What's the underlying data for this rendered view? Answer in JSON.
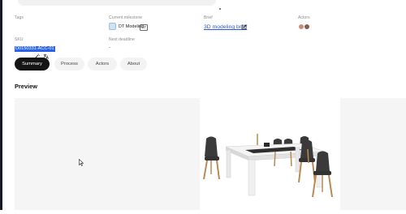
{
  "fields": {
    "tags_label": "Tags",
    "milestone_label": "Current milestone",
    "milestone_value": "DT Modeling",
    "milestone_badge": "AT",
    "brief_label": "Brief",
    "brief_link": "3D modeling brief",
    "actors_label": "Actors",
    "sku_label": "SKU",
    "sku_value": "D0150331-ACC-01",
    "deadline_label": "Next deadline",
    "deadline_value": "-"
  },
  "tabs": [
    {
      "label": "Summary",
      "active": true
    },
    {
      "label": "Process",
      "active": false
    },
    {
      "label": "Actors",
      "active": false
    },
    {
      "label": "About",
      "active": false
    }
  ],
  "preview": {
    "title": "Preview",
    "image_subject": "dining-table-with-chairs"
  },
  "colors": {
    "link": "#2f58d6",
    "tab_active_bg": "#151515",
    "sku_highlight": "#2a63e5"
  }
}
